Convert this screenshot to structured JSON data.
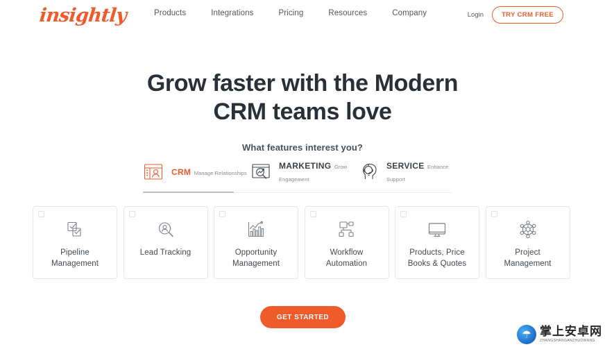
{
  "brand": {
    "logo_text": "insightly",
    "accent_color": "#ef5b2b",
    "heading_color": "#2b3038"
  },
  "header": {
    "nav_items": [
      {
        "label": "Products"
      },
      {
        "label": "Integrations"
      },
      {
        "label": "Pricing"
      },
      {
        "label": "Resources"
      },
      {
        "label": "Company"
      }
    ],
    "login_label": "Login",
    "cta_label": "TRY CRM FREE"
  },
  "hero": {
    "heading_line1": "Grow faster with the Modern",
    "heading_line2": "CRM teams love",
    "subheading": "What features interest you?"
  },
  "tabs": [
    {
      "id": "crm",
      "title": "CRM",
      "desc": "Manage Relationships",
      "icon": "contact-card-icon",
      "active": true
    },
    {
      "id": "marketing",
      "title": "MARKETING",
      "desc": "Grow Engagement",
      "icon": "analytics-window-icon",
      "active": false
    },
    {
      "id": "service",
      "title": "SERVICE",
      "desc": "Enhance Support",
      "icon": "headset-agent-icon",
      "active": false
    }
  ],
  "feature_cards": [
    {
      "label_line1": "Pipeline",
      "label_line2": "Management",
      "icon": "checklist-tasks-icon",
      "checked": false
    },
    {
      "label_line1": "Lead Tracking",
      "label_line2": "",
      "icon": "person-search-icon",
      "checked": false
    },
    {
      "label_line1": "Opportunity",
      "label_line2": "Management",
      "icon": "bar-chart-growth-icon",
      "checked": false
    },
    {
      "label_line1": "Workflow",
      "label_line2": "Automation",
      "icon": "flow-nodes-icon",
      "checked": false
    },
    {
      "label_line1": "Products, Price",
      "label_line2": "Books & Quotes",
      "icon": "monitor-icon",
      "checked": false
    },
    {
      "label_line1": "Project",
      "label_line2": "Management",
      "icon": "network-gear-icon",
      "checked": false
    }
  ],
  "cta": {
    "label": "GET STARTED"
  },
  "watermark": {
    "chinese": "掌上安卓网",
    "pinyin": "ZHANGSHANGANZHUOWANG"
  }
}
